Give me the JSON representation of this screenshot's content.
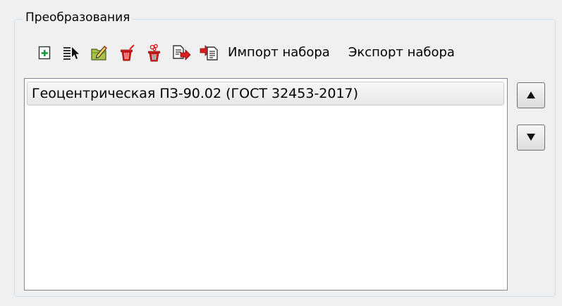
{
  "group": {
    "title": "Преобразования"
  },
  "toolbar": {
    "icons": [
      "add-icon",
      "select-icon",
      "edit-icon",
      "delete-icon",
      "delete-all-icon",
      "export-icon",
      "import-icon"
    ],
    "import_label": "Импорт набора",
    "export_label": "Экспорт набора"
  },
  "list": {
    "items": [
      "Геоцентрическая ПЗ-90.02 (ГОСТ 32453-2017)"
    ]
  },
  "buttons": {
    "up_icon": "arrow-up-icon",
    "down_icon": "arrow-down-icon"
  },
  "colors": {
    "group_border": "#d5dfe5",
    "list_border": "#828790",
    "accent_green": "#1a9a3a",
    "accent_red": "#cc1a1a"
  }
}
